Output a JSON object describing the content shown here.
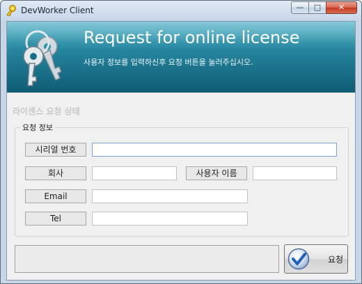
{
  "window": {
    "title": "DevWorker Client",
    "icon": "key-icon",
    "minimize_glyph": "—",
    "maximize_glyph": "□",
    "close_glyph": "✕"
  },
  "banner": {
    "title": "Request for online license",
    "subtitle": "사용자 정보를 입력하신후 요청 버튼을 눌러주십시오.",
    "icon": "keys-icon",
    "colors": {
      "top": "#5ab8cc",
      "bottom": "#0f5d75"
    }
  },
  "status": {
    "label": "라이센스 요청 상태",
    "message": ""
  },
  "request_info": {
    "group_title": "요청 정보",
    "serial_label": "시리얼 번호",
    "serial_value": "",
    "company_label": "회사",
    "company_value": "",
    "username_label": "사용자 이름",
    "username_value": "",
    "email_label": "Email",
    "email_value": "",
    "tel_label": "Tel",
    "tel_value": ""
  },
  "actions": {
    "request_label": "요청",
    "request_icon": "check-icon"
  }
}
